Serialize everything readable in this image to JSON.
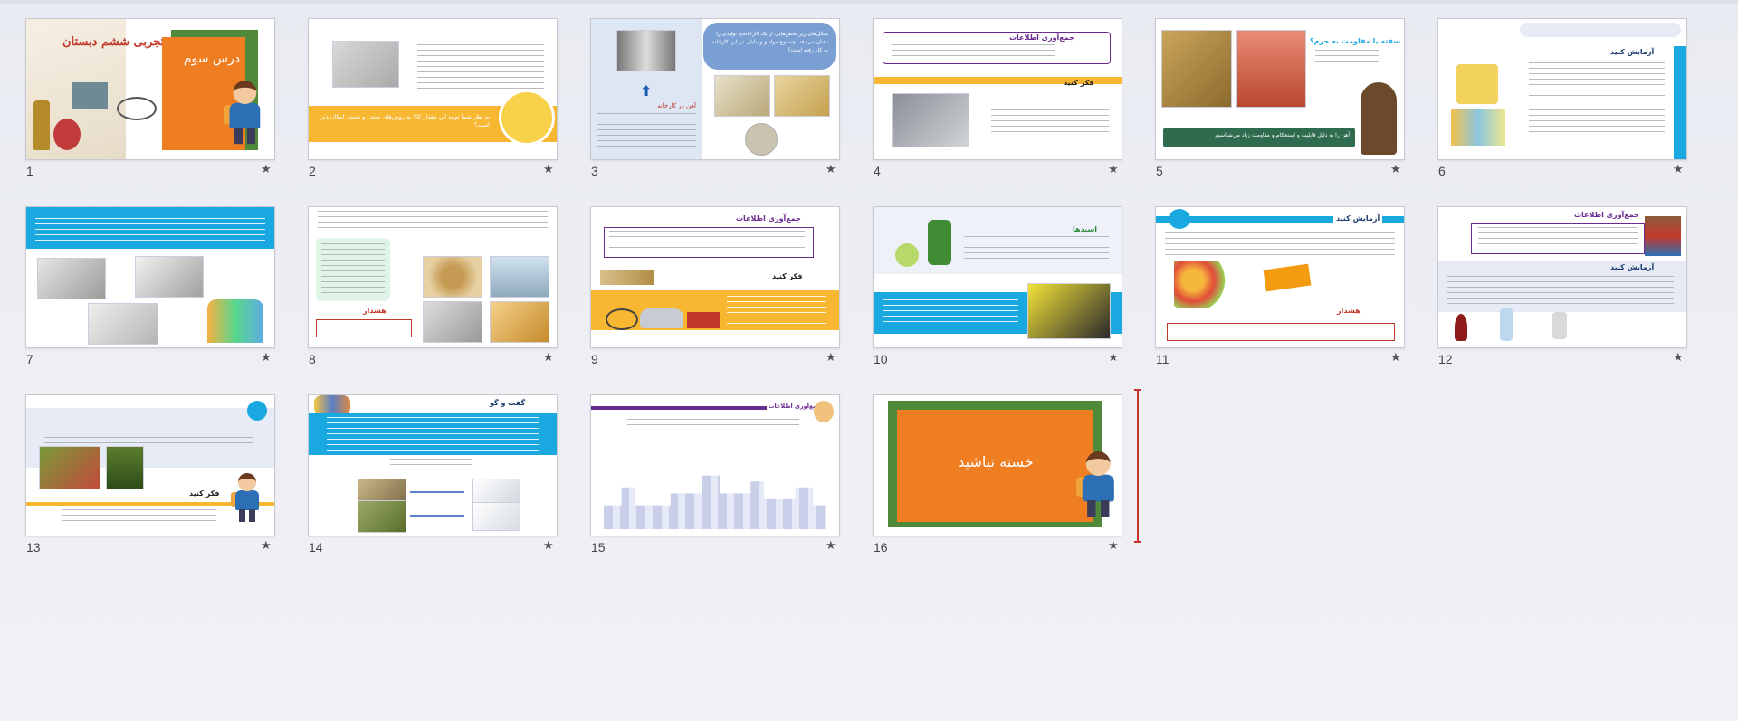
{
  "slides": [
    {
      "number": "1",
      "title": "درس سوم",
      "subtitle": "علوم تجربی ششم دبستان",
      "star": "★"
    },
    {
      "number": "2",
      "question": "به نظر شما تولید این مقدار کالا به روش‌های سنتی و دستی امکان‌پذیر است؟",
      "star": "★"
    },
    {
      "number": "3",
      "bubble": "شکل‌های زیر بخش‌هایی از یک کارخانه‌ی تولیدی را نشان می‌دهد. چه نوع مواد و وسایلی در این کارخانه به کار رفته است؟",
      "label": "آهن در کارخانه",
      "star": "★"
    },
    {
      "number": "4",
      "title": "جمع‌آوری اطلاعات",
      "think": "فکر کنید",
      "star": "★"
    },
    {
      "number": "5",
      "title": "سفته یا مقاومت به جرم؟",
      "caption": "آهن را به دلیل قابلیت و استحکام و مقاومت زیاد می‌شناسیم",
      "star": "★"
    },
    {
      "number": "6",
      "title": "آزمایش کنید",
      "star": "★"
    },
    {
      "number": "7",
      "star": "★"
    },
    {
      "number": "8",
      "warning": "هشدار",
      "star": "★"
    },
    {
      "number": "9",
      "title": "جمع‌آوری اطلاعات",
      "think": "فکر کنید",
      "star": "★"
    },
    {
      "number": "10",
      "title": "اسیدها",
      "star": "★"
    },
    {
      "number": "11",
      "title": "آزمایش کنید",
      "warning": "هشدار",
      "star": "★"
    },
    {
      "number": "12",
      "title": "جمع‌آوری اطلاعات",
      "subtitle": "آزمایش کنید",
      "star": "★"
    },
    {
      "number": "13",
      "think": "فکر کنید",
      "star": "★"
    },
    {
      "number": "14",
      "title": "گفت و گو",
      "star": "★"
    },
    {
      "number": "15",
      "title": "جمع‌آوری اطلاعات",
      "star": "★"
    },
    {
      "number": "16",
      "title": "خسته نباشید",
      "star": "★"
    }
  ],
  "colors": {
    "orange": "#ef7d22",
    "green": "#4f8a3b",
    "blue": "#1aa8e0",
    "yellow": "#f7b731",
    "purple": "#6a2b8f"
  }
}
